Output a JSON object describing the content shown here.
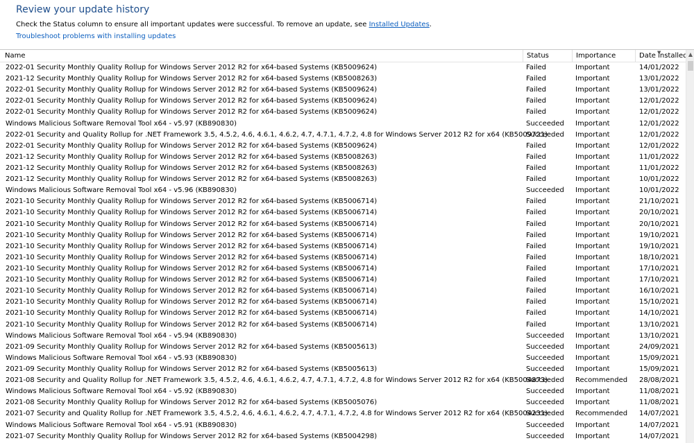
{
  "header": {
    "title": "Review your update history",
    "description_prefix": "Check the Status column to ensure all important updates were successful. To remove an update, see ",
    "installed_updates_link": "Installed Updates",
    "description_suffix": ".",
    "troubleshoot_link": "Troubleshoot problems with installing updates"
  },
  "columns": {
    "name": "Name",
    "status": "Status",
    "importance": "Importance",
    "date_installed": "Date installed"
  },
  "rows": [
    {
      "name": "2022-01 Security Monthly Quality Rollup for Windows Server 2012 R2 for x64-based Systems (KB5009624)",
      "status": "Failed",
      "importance": "Important",
      "date": "14/01/2022"
    },
    {
      "name": "2021-12 Security Monthly Quality Rollup for Windows Server 2012 R2 for x64-based Systems (KB5008263)",
      "status": "Failed",
      "importance": "Important",
      "date": "13/01/2022"
    },
    {
      "name": "2022-01 Security Monthly Quality Rollup for Windows Server 2012 R2 for x64-based Systems (KB5009624)",
      "status": "Failed",
      "importance": "Important",
      "date": "13/01/2022"
    },
    {
      "name": "2022-01 Security Monthly Quality Rollup for Windows Server 2012 R2 for x64-based Systems (KB5009624)",
      "status": "Failed",
      "importance": "Important",
      "date": "12/01/2022"
    },
    {
      "name": "2022-01 Security Monthly Quality Rollup for Windows Server 2012 R2 for x64-based Systems (KB5009624)",
      "status": "Failed",
      "importance": "Important",
      "date": "12/01/2022"
    },
    {
      "name": "Windows Malicious Software Removal Tool x64 - v5.97 (KB890830)",
      "status": "Succeeded",
      "importance": "Important",
      "date": "12/01/2022"
    },
    {
      "name": "2022-01 Security and Quality Rollup for .NET Framework 3.5, 4.5.2, 4.6, 4.6.1, 4.6.2, 4.7, 4.7.1, 4.7.2, 4.8 for Windows Server 2012 R2 for x64 (KB5009721)",
      "status": "Succeeded",
      "importance": "Important",
      "date": "12/01/2022"
    },
    {
      "name": "2022-01 Security Monthly Quality Rollup for Windows Server 2012 R2 for x64-based Systems (KB5009624)",
      "status": "Failed",
      "importance": "Important",
      "date": "12/01/2022"
    },
    {
      "name": "2021-12 Security Monthly Quality Rollup for Windows Server 2012 R2 for x64-based Systems (KB5008263)",
      "status": "Failed",
      "importance": "Important",
      "date": "11/01/2022"
    },
    {
      "name": "2021-12 Security Monthly Quality Rollup for Windows Server 2012 R2 for x64-based Systems (KB5008263)",
      "status": "Failed",
      "importance": "Important",
      "date": "11/01/2022"
    },
    {
      "name": "2021-12 Security Monthly Quality Rollup for Windows Server 2012 R2 for x64-based Systems (KB5008263)",
      "status": "Failed",
      "importance": "Important",
      "date": "10/01/2022"
    },
    {
      "name": "Windows Malicious Software Removal Tool x64 - v5.96 (KB890830)",
      "status": "Succeeded",
      "importance": "Important",
      "date": "10/01/2022"
    },
    {
      "name": "2021-10 Security Monthly Quality Rollup for Windows Server 2012 R2 for x64-based Systems (KB5006714)",
      "status": "Failed",
      "importance": "Important",
      "date": "21/10/2021"
    },
    {
      "name": "2021-10 Security Monthly Quality Rollup for Windows Server 2012 R2 for x64-based Systems (KB5006714)",
      "status": "Failed",
      "importance": "Important",
      "date": "20/10/2021"
    },
    {
      "name": "2021-10 Security Monthly Quality Rollup for Windows Server 2012 R2 for x64-based Systems (KB5006714)",
      "status": "Failed",
      "importance": "Important",
      "date": "20/10/2021"
    },
    {
      "name": "2021-10 Security Monthly Quality Rollup for Windows Server 2012 R2 for x64-based Systems (KB5006714)",
      "status": "Failed",
      "importance": "Important",
      "date": "19/10/2021"
    },
    {
      "name": "2021-10 Security Monthly Quality Rollup for Windows Server 2012 R2 for x64-based Systems (KB5006714)",
      "status": "Failed",
      "importance": "Important",
      "date": "19/10/2021"
    },
    {
      "name": "2021-10 Security Monthly Quality Rollup for Windows Server 2012 R2 for x64-based Systems (KB5006714)",
      "status": "Failed",
      "importance": "Important",
      "date": "18/10/2021"
    },
    {
      "name": "2021-10 Security Monthly Quality Rollup for Windows Server 2012 R2 for x64-based Systems (KB5006714)",
      "status": "Failed",
      "importance": "Important",
      "date": "17/10/2021"
    },
    {
      "name": "2021-10 Security Monthly Quality Rollup for Windows Server 2012 R2 for x64-based Systems (KB5006714)",
      "status": "Failed",
      "importance": "Important",
      "date": "17/10/2021"
    },
    {
      "name": "2021-10 Security Monthly Quality Rollup for Windows Server 2012 R2 for x64-based Systems (KB5006714)",
      "status": "Failed",
      "importance": "Important",
      "date": "16/10/2021"
    },
    {
      "name": "2021-10 Security Monthly Quality Rollup for Windows Server 2012 R2 for x64-based Systems (KB5006714)",
      "status": "Failed",
      "importance": "Important",
      "date": "15/10/2021"
    },
    {
      "name": "2021-10 Security Monthly Quality Rollup for Windows Server 2012 R2 for x64-based Systems (KB5006714)",
      "status": "Failed",
      "importance": "Important",
      "date": "14/10/2021"
    },
    {
      "name": "2021-10 Security Monthly Quality Rollup for Windows Server 2012 R2 for x64-based Systems (KB5006714)",
      "status": "Failed",
      "importance": "Important",
      "date": "13/10/2021"
    },
    {
      "name": "Windows Malicious Software Removal Tool x64 - v5.94 (KB890830)",
      "status": "Succeeded",
      "importance": "Important",
      "date": "13/10/2021"
    },
    {
      "name": "2021-09 Security Monthly Quality Rollup for Windows Server 2012 R2 for x64-based Systems (KB5005613)",
      "status": "Succeeded",
      "importance": "Important",
      "date": "24/09/2021"
    },
    {
      "name": "Windows Malicious Software Removal Tool x64 - v5.93 (KB890830)",
      "status": "Succeeded",
      "importance": "Important",
      "date": "15/09/2021"
    },
    {
      "name": "2021-09 Security Monthly Quality Rollup for Windows Server 2012 R2 for x64-based Systems (KB5005613)",
      "status": "Succeeded",
      "importance": "Important",
      "date": "15/09/2021"
    },
    {
      "name": "2021-08 Security and Quality Rollup for .NET Framework 3.5, 4.5.2, 4.6, 4.6.1, 4.6.2, 4.7, 4.7.1, 4.7.2, 4.8 for Windows Server 2012 R2 for x64 (KB5004873)",
      "status": "Succeeded",
      "importance": "Recommended",
      "date": "28/08/2021"
    },
    {
      "name": "Windows Malicious Software Removal Tool x64 - v5.92 (KB890830)",
      "status": "Succeeded",
      "importance": "Important",
      "date": "11/08/2021"
    },
    {
      "name": "2021-08 Security Monthly Quality Rollup for Windows Server 2012 R2 for x64-based Systems (KB5005076)",
      "status": "Succeeded",
      "importance": "Important",
      "date": "11/08/2021"
    },
    {
      "name": "2021-07 Security and Quality Rollup for .NET Framework 3.5, 4.5.2, 4.6, 4.6.1, 4.6.2, 4.7, 4.7.1, 4.7.2, 4.8 for Windows Server 2012 R2 for x64 (KB5004231)",
      "status": "Succeeded",
      "importance": "Recommended",
      "date": "14/07/2021"
    },
    {
      "name": "Windows Malicious Software Removal Tool x64 - v5.91 (KB890830)",
      "status": "Succeeded",
      "importance": "Important",
      "date": "14/07/2021"
    },
    {
      "name": "2021-07 Security Monthly Quality Rollup for Windows Server 2012 R2 for x64-based Systems (KB5004298)",
      "status": "Succeeded",
      "importance": "Important",
      "date": "14/07/2021"
    }
  ],
  "icons": {
    "sort": "sort-descending-icon",
    "scroll_up": "scroll-up-arrow-icon"
  },
  "colors": {
    "title": "#1e4e8c",
    "link": "#0b5ebf"
  }
}
